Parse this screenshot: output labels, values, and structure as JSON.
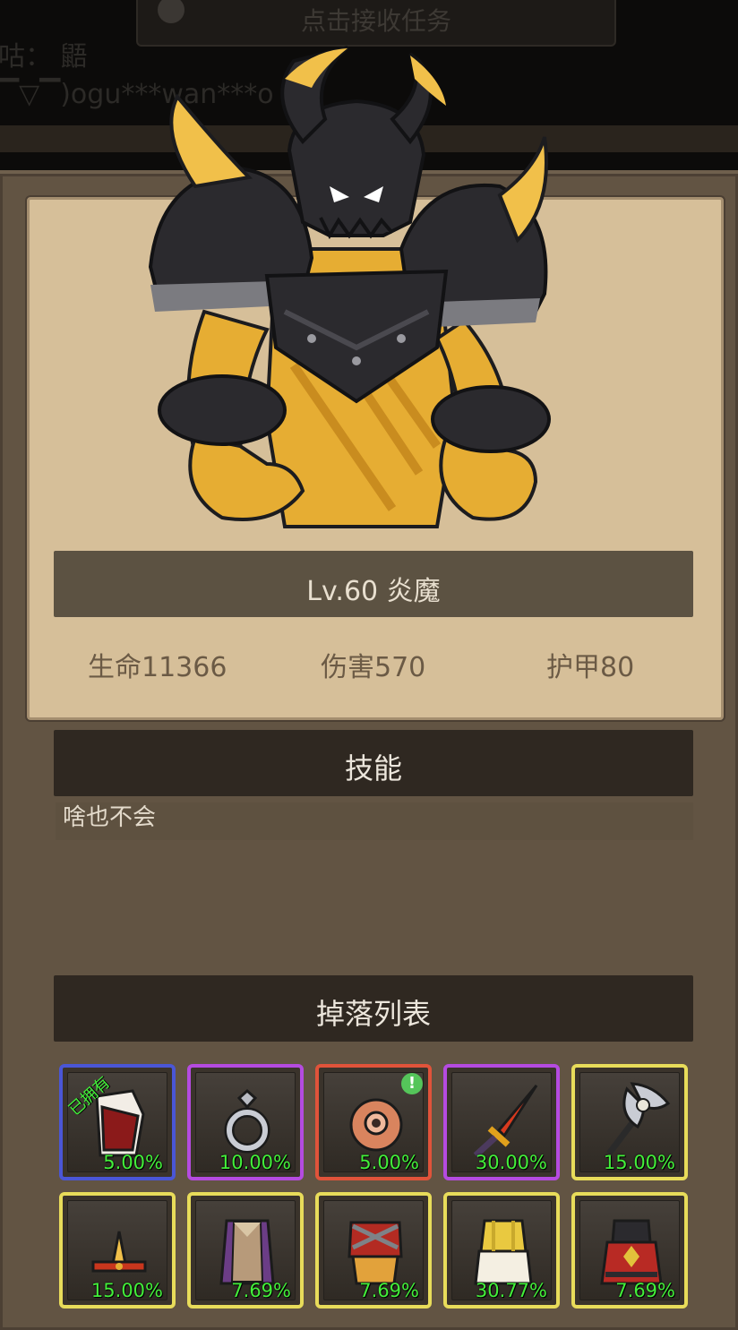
{
  "header": {
    "task_button_label": "点击接收任务",
    "chat_line_1": "咕：  鼯",
    "chat_line_2": "▔▽▔)ogu***wan***o"
  },
  "monster": {
    "name_line": "Lv.60 炎魔",
    "stats": {
      "hp": "生命11366",
      "damage": "伤害570",
      "armor": "护甲80"
    }
  },
  "skills": {
    "title": "技能",
    "text": "啥也不会"
  },
  "drops": {
    "title": "掉落列表",
    "items": [
      {
        "icon": "red-chest-armor-icon",
        "rarity_color": "#4a56d6",
        "percent": "5.00%",
        "owned_label": "已拥有",
        "alert": false
      },
      {
        "icon": "silver-ring-icon",
        "rarity_color": "#b54be0",
        "percent": "10.00%",
        "owned_label": "",
        "alert": false
      },
      {
        "icon": "bronze-orb-icon",
        "rarity_color": "#e0533a",
        "percent": "5.00%",
        "owned_label": "",
        "alert": true
      },
      {
        "icon": "flame-sword-icon",
        "rarity_color": "#b54be0",
        "percent": "30.00%",
        "owned_label": "",
        "alert": false
      },
      {
        "icon": "skull-axe-icon",
        "rarity_color": "#e8dc5a",
        "percent": "15.00%",
        "owned_label": "",
        "alert": false
      },
      {
        "icon": "horned-crown-icon",
        "rarity_color": "#e8dc5a",
        "percent": "15.00%",
        "owned_label": "",
        "alert": false
      },
      {
        "icon": "purple-cloak-icon",
        "rarity_color": "#e8dc5a",
        "percent": "7.69%",
        "owned_label": "",
        "alert": false
      },
      {
        "icon": "red-cuirass-icon",
        "rarity_color": "#e8dc5a",
        "percent": "7.69%",
        "owned_label": "",
        "alert": false
      },
      {
        "icon": "white-robe-icon",
        "rarity_color": "#e8dc5a",
        "percent": "30.77%",
        "owned_label": "",
        "alert": false
      },
      {
        "icon": "crimson-robe-icon",
        "rarity_color": "#e8dc5a",
        "percent": "7.69%",
        "owned_label": "",
        "alert": false
      }
    ]
  },
  "colors": {
    "percent_green": "#43f03a",
    "card_bg": "#d6bf99",
    "panel_bg": "#625443"
  }
}
